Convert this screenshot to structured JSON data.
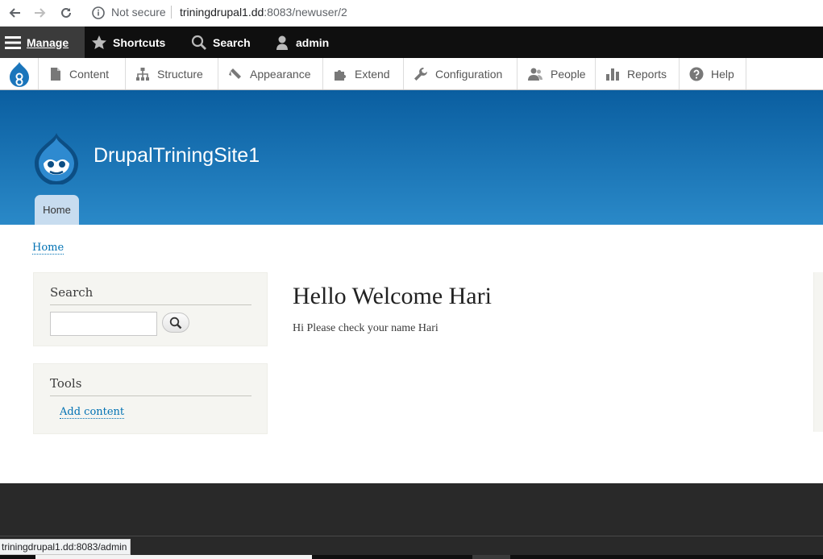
{
  "browser": {
    "security_label": "Not secure",
    "url_host": "triningdrupal1.dd",
    "url_rest": ":8083/newuser/2"
  },
  "toolbar": {
    "manage": "Manage",
    "shortcuts": "Shortcuts",
    "search": "Search",
    "user": "admin"
  },
  "tray": {
    "items": [
      {
        "label": "Content",
        "icon": "file-icon"
      },
      {
        "label": "Structure",
        "icon": "sitemap-icon"
      },
      {
        "label": "Appearance",
        "icon": "brush-icon"
      },
      {
        "label": "Extend",
        "icon": "puzzle-icon"
      },
      {
        "label": "Configuration",
        "icon": "wrench-icon"
      },
      {
        "label": "People",
        "icon": "people-icon"
      },
      {
        "label": "Reports",
        "icon": "bar-chart-icon"
      },
      {
        "label": "Help",
        "icon": "question-icon"
      }
    ]
  },
  "header": {
    "site_name": "DrupalTriningSite1",
    "home_tab": "Home"
  },
  "breadcrumb": {
    "home": "Home"
  },
  "sidebar": {
    "search_title": "Search",
    "tools_title": "Tools",
    "add_content": "Add content"
  },
  "main": {
    "title": "Hello Welcome Hari",
    "body": "Hi Please check your name Hari"
  },
  "status_bar": {
    "url": "triningdrupal1.dd:8083/admin"
  },
  "colors": {
    "header_top": "#0a5ea0",
    "header_bottom": "#2a89c8",
    "link": "#0071b3",
    "toolbar": "#0f0f0f",
    "footer": "#292929"
  }
}
